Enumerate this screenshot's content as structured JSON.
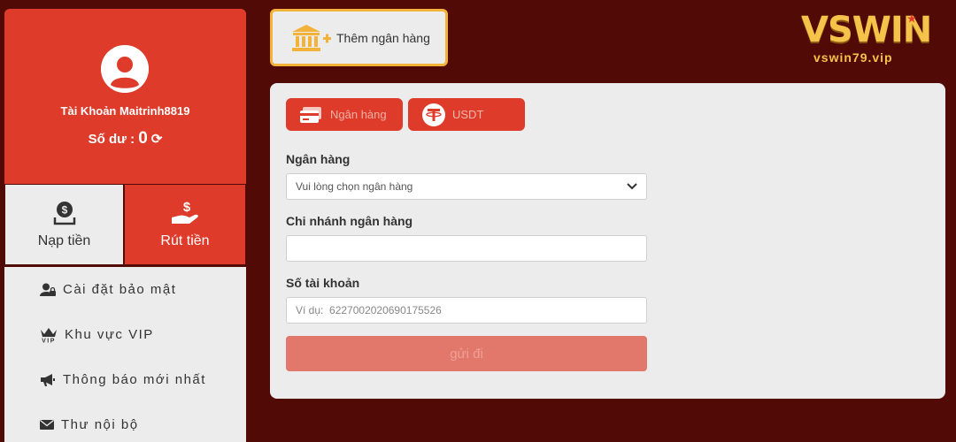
{
  "profile": {
    "account": "Tài Khoản Maitrinh8819",
    "balance_label": "Số dư :",
    "balance_value": "0"
  },
  "actions": {
    "deposit": "Nạp tiền",
    "withdraw": "Rút tiền"
  },
  "menu": {
    "items": [
      {
        "label": "Cài đặt bảo mật",
        "icon": "user-lock-icon"
      },
      {
        "label": "Khu vực VIP",
        "icon": "vip-crown-icon"
      },
      {
        "label": "Thông báo mới nhất",
        "icon": "megaphone-icon"
      },
      {
        "label": "Thư nội bộ",
        "icon": "envelope-icon"
      }
    ]
  },
  "add_bank": {
    "label": "Thêm ngân hàng",
    "icon": "bank-plus-icon"
  },
  "logo": {
    "main": "VSWIN",
    "sub": "vswin79.vip"
  },
  "tabs": [
    {
      "label": "Ngân hàng",
      "icon": "bank-card-icon"
    },
    {
      "label": "USDT",
      "icon": "tether-icon"
    }
  ],
  "form": {
    "bank_label": "Ngân hàng",
    "bank_select_value": "Vui lòng chọn ngân hàng",
    "branch_label": "Chi nhánh ngân hàng",
    "branch_value": "",
    "account_label": "Số tài khoản",
    "account_placeholder": "Ví dụ:  6227002020690175526",
    "submit": "gửi đi"
  },
  "colors": {
    "background": "#520a06",
    "accent_red": "#de3b2a",
    "gold": "#f5c24a",
    "panel": "#ececec"
  }
}
